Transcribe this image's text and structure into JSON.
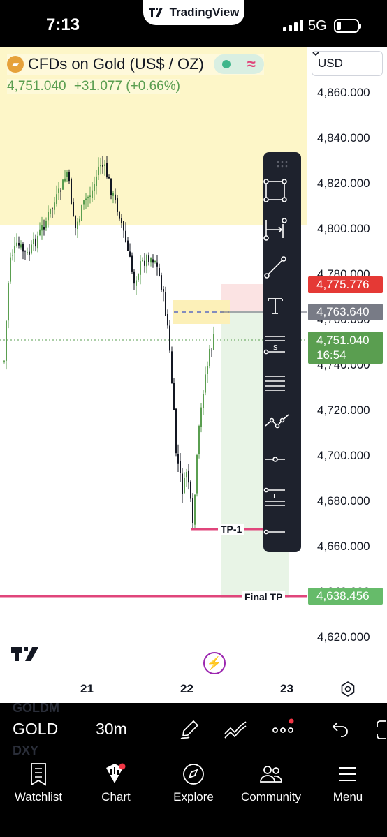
{
  "status_bar": {
    "time": "7:13",
    "brand": "TradingView",
    "network": "5G"
  },
  "symbol": {
    "title": "CFDs on Gold (US$ / OZ)",
    "last": "4,751.040",
    "change": "+31.077 (+0.66%)",
    "currency": "USD"
  },
  "price_axis": {
    "labels": [
      "4,860.000",
      "4,840.000",
      "4,820.000",
      "4,800.000",
      "4,780.000",
      "4,760.000",
      "4,740.000",
      "4,720.000",
      "4,700.000",
      "4,680.000",
      "4,660.000",
      "4,640.000",
      "4,620.000"
    ],
    "tags": {
      "stop": "4,775.776",
      "entry": "4,763.640",
      "last": "4,751.040",
      "countdown": "16:54",
      "final_tp": "4,638.456"
    }
  },
  "drawings": {
    "tp1_label": "TP-1",
    "final_tp_label": "Final TP"
  },
  "time_axis": [
    "21",
    "22",
    "23"
  ],
  "drawing_tools": [
    {
      "name": "rectangle-tool-icon"
    },
    {
      "name": "measure-tool-icon"
    },
    {
      "name": "trend-line-tool-icon"
    },
    {
      "name": "text-tool-icon"
    },
    {
      "name": "short-position-tool-icon"
    },
    {
      "name": "parallel-channel-tool-icon"
    },
    {
      "name": "path-tool-icon"
    },
    {
      "name": "horizontal-ray-tool-icon"
    },
    {
      "name": "long-position-tool-icon"
    },
    {
      "name": "horizontal-line-tool-icon"
    }
  ],
  "controls": {
    "symbol": "GOLD",
    "interval": "30m",
    "ghost_above": "GOLDM",
    "ghost_below": "DXY"
  },
  "bottom_nav": {
    "items": [
      {
        "label": "Watchlist"
      },
      {
        "label": "Chart"
      },
      {
        "label": "Explore"
      },
      {
        "label": "Community"
      },
      {
        "label": "Menu"
      }
    ]
  },
  "colors": {
    "up": "#5a9e50",
    "down": "#131722",
    "zone_yellow": "#fdf6c8",
    "stop_red": "#e53935",
    "target_green": "#66bb6a",
    "tp_pink": "#e0457b",
    "entry_grey": "#787b86"
  }
}
